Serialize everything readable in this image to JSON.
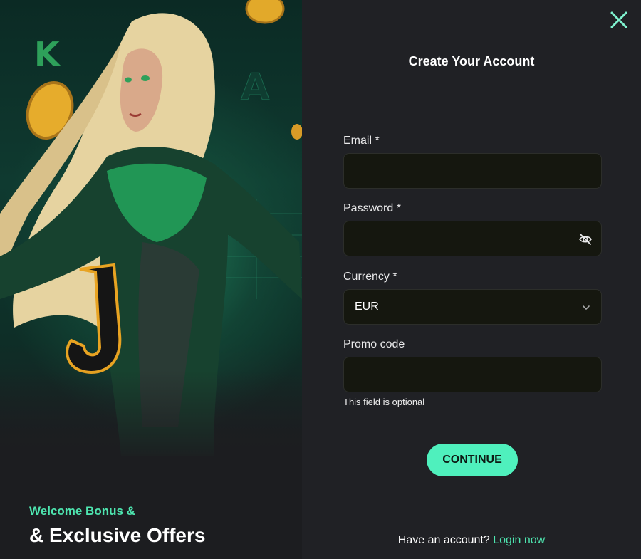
{
  "promo": {
    "subtitle": "Welcome Bonus &",
    "title": "& Exclusive Offers",
    "accent_color": "#4ee6b0"
  },
  "form": {
    "title": "Create Your Account",
    "close_icon": "close-icon",
    "email": {
      "label": "Email *",
      "value": ""
    },
    "password": {
      "label": "Password *",
      "value": "",
      "toggle_icon": "eye-off-icon"
    },
    "currency": {
      "label": "Currency *",
      "selected": "EUR",
      "icon": "chevron-down-icon"
    },
    "promo_code": {
      "label": "Promo code",
      "value": "",
      "hint": "This field is optional"
    },
    "continue_label": "CONTINUE",
    "footer": {
      "text": "Have an account?",
      "link": "Login now"
    }
  },
  "colors": {
    "accent": "#4ff0bd",
    "panel_bg": "#202125",
    "input_bg": "#15170f"
  }
}
